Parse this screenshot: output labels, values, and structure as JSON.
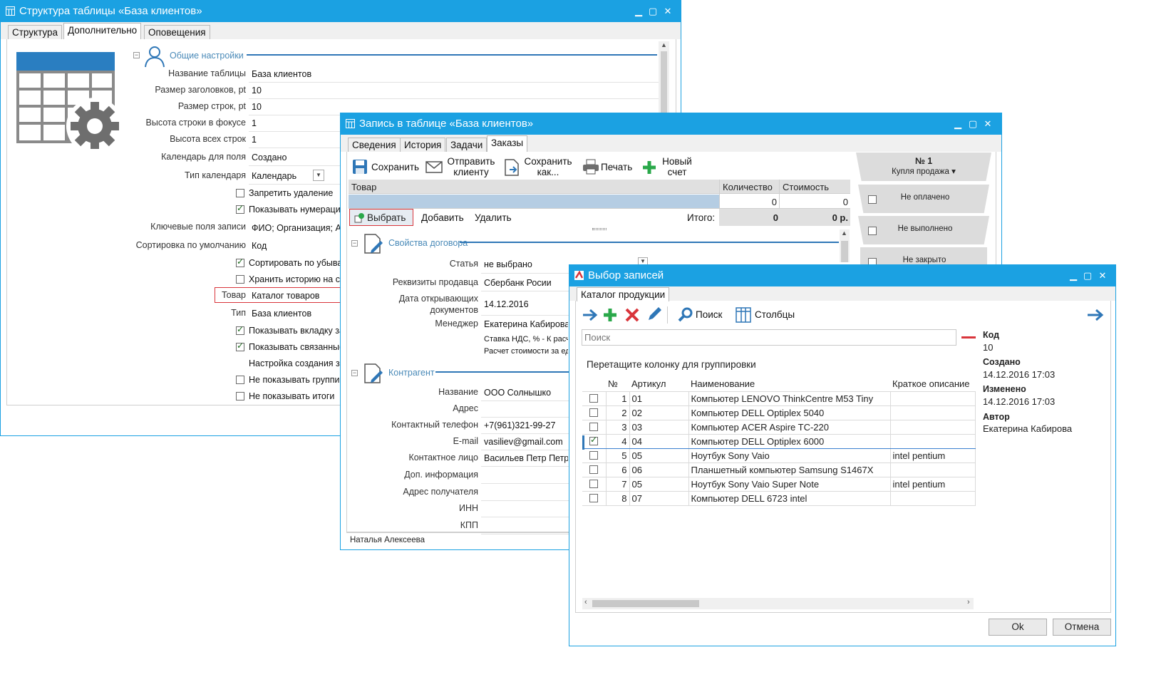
{
  "w1": {
    "title": "Структура таблицы «База клиентов»",
    "tabs": [
      "Структура",
      "Дополнительно",
      "Оповещения"
    ],
    "section": "Общие настройки",
    "fields": [
      {
        "label": "Название таблицы",
        "value": "База клиентов"
      },
      {
        "label": "Размер заголовков, pt",
        "value": "10"
      },
      {
        "label": "Размер строк, pt",
        "value": "10"
      },
      {
        "label": "Высота строки в фокусе",
        "value": "1"
      },
      {
        "label": "Высота всех строк",
        "value": "1"
      },
      {
        "label": "Календарь для поля",
        "value": "Создано"
      },
      {
        "label": "Тип календаря",
        "value": "Календарь"
      }
    ],
    "cb1": "Запретить удаление",
    "cb2": "Показывать нумерацию",
    "key_label": "Ключевые поля записи",
    "key_value": "ФИО; Организация; Адрес",
    "sort_label": "Сортировка по умолчанию",
    "sort_value": "Код",
    "cb3": "Сортировать по убыванию",
    "cb4": "Хранить историю на сервере",
    "tovar_label": "Товар",
    "tovar_value": "Каталог товаров",
    "type_label": "Тип",
    "type_value": "База клиентов",
    "cb5": "Показывать вкладку заказов",
    "cb6": "Показывать связанные записи",
    "setting": "Настройка создания записей",
    "cb7": "Не показывать группировку",
    "cb8": "Не показывать итоги"
  },
  "w2": {
    "title": "Запись в таблице «База клиентов»",
    "tabs": [
      "Сведения",
      "История",
      "Задачи",
      "Заказы"
    ],
    "toolbar": {
      "save": "Сохранить",
      "send1": "Отправить",
      "send2": "клиенту",
      "saveas1": "Сохранить",
      "saveas2": "как...",
      "print": "Печать",
      "new1": "Новый",
      "new2": "счет"
    },
    "grid": {
      "col_item": "Товар",
      "col_qty": "Количество",
      "col_cost": "Стоимость",
      "qty": "0",
      "cost": "0"
    },
    "actions": {
      "choose": "Выбрать",
      "add": "Добавить",
      "delete": "Удалить",
      "total_label": "Итого:",
      "total_qty": "0",
      "total_cost": "0 р."
    },
    "status": {
      "number": "№ 1",
      "kind": "Купля продажа",
      "s1": "Не оплачено",
      "s2": "Не выполнено",
      "s3": "Не закрыто"
    },
    "contract": "Свойства договора",
    "c_fields": [
      {
        "label": "Статья",
        "value": "не выбрано"
      },
      {
        "label": "Реквизиты продавца",
        "value": "Сбербанк Росии"
      },
      {
        "label": "Дата открывающих документов",
        "value": "14.12.2016"
      },
      {
        "label": "Менеджер",
        "value": "Екатерина Кабирова"
      }
    ],
    "vat": "Ставка НДС, % -  К расчету",
    "calc": "Расчет стоимости за единицу",
    "contractor": "Контрагент",
    "k_fields": [
      {
        "label": "Название",
        "value": "ООО Солнышко"
      },
      {
        "label": "Адрес",
        "value": ""
      },
      {
        "label": "Контактный телефон",
        "value": "+7(961)321-99-27"
      },
      {
        "label": "E-mail",
        "value": "vasiliev@gmail.com"
      },
      {
        "label": "Контактное лицо",
        "value": "Васильев Петр Петрович"
      },
      {
        "label": "Доп. информация",
        "value": ""
      },
      {
        "label": "Адрес получателя",
        "value": ""
      },
      {
        "label": "ИНН",
        "value": ""
      },
      {
        "label": "КПП",
        "value": ""
      }
    ],
    "footer": "Наталья Алексеева"
  },
  "w3": {
    "title": "Выбор записей",
    "tab": "Каталог продукции",
    "search_label": "Поиск",
    "columns_label": "Столбцы",
    "search_placeholder": "Поиск",
    "group_hint": "Перетащите колонку для группировки",
    "headers": [
      "№",
      "Артикул",
      "Наименование",
      "Краткое описание"
    ],
    "rows": [
      {
        "n": "1",
        "art": "01",
        "name": "Компьютер  LENOVO ThinkCentre M53 Tiny",
        "desc": "",
        "checked": false
      },
      {
        "n": "2",
        "art": "02",
        "name": "Компьютер  DELL Optiplex 5040",
        "desc": "",
        "checked": false
      },
      {
        "n": "3",
        "art": "03",
        "name": "Компьютер  ACER Aspire TC-220",
        "desc": "",
        "checked": false
      },
      {
        "n": "4",
        "art": "04",
        "name": "Компьютер  DELL Optiplex 6000",
        "desc": "",
        "checked": true
      },
      {
        "n": "5",
        "art": "05",
        "name": "Ноутбук Sony Vaio",
        "desc": "intel pentium",
        "checked": false
      },
      {
        "n": "6",
        "art": "06",
        "name": "Планшетный компьютер Samsung S1467X",
        "desc": "",
        "checked": false
      },
      {
        "n": "7",
        "art": "05",
        "name": "Ноутбук Sony Vaio Super Note",
        "desc": "intel pentium",
        "checked": false
      },
      {
        "n": "8",
        "art": "07",
        "name": "Компьютер  DELL 6723 intel",
        "desc": "",
        "checked": false
      }
    ],
    "info": {
      "code_l": "Код",
      "code_v": "10",
      "created_l": "Создано",
      "created_v": "14.12.2016 17:03",
      "changed_l": "Изменено",
      "changed_v": "14.12.2016 17:03",
      "author_l": "Автор",
      "author_v": "Екатерина Кабирова"
    },
    "ok": "Ok",
    "cancel": "Отмена"
  }
}
